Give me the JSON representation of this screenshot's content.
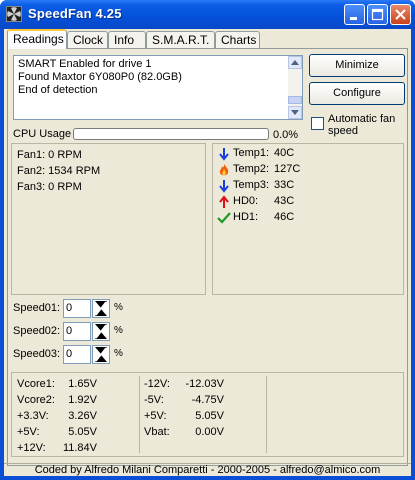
{
  "window": {
    "title": "SpeedFan 4.25",
    "icons": {
      "app": "speedfan-app-icon",
      "minimize": "minimize-icon",
      "maximize": "maximize-icon",
      "close": "close-icon"
    }
  },
  "tabs": [
    {
      "label": "Readings",
      "active": true
    },
    {
      "label": "Clock",
      "active": false
    },
    {
      "label": "Info",
      "active": false
    },
    {
      "label": "S.M.A.R.T.",
      "active": false
    },
    {
      "label": "Charts",
      "active": false
    }
  ],
  "log": {
    "lines": [
      "SMART Enabled for drive 1",
      "Found Maxtor 6Y080P0 (82.0GB)",
      "End of detection"
    ]
  },
  "buttons": {
    "minimize": "Minimize",
    "configure": "Configure"
  },
  "auto_fan": {
    "label": "Automatic fan speed",
    "checked": false
  },
  "cpu": {
    "label": "CPU Usage",
    "value": "0.0%",
    "fraction": 0.0
  },
  "fans": [
    "Fan1: 0 RPM",
    "Fan2: 1534 RPM",
    "Fan3: 0 RPM"
  ],
  "temps": [
    {
      "label": "Temp1:",
      "value": "40C",
      "icon": "arrow-down-icon",
      "color": "#1a3fe0"
    },
    {
      "label": "Temp2:",
      "value": "127C",
      "icon": "flame-icon",
      "color": "#e03010"
    },
    {
      "label": "Temp3:",
      "value": "33C",
      "icon": "arrow-down-icon",
      "color": "#1a3fe0"
    },
    {
      "label": "HD0:",
      "value": "43C",
      "icon": "arrow-up-icon",
      "color": "#e01010"
    },
    {
      "label": "HD1:",
      "value": "46C",
      "icon": "check-icon",
      "color": "#1f9a22"
    }
  ],
  "speeds": [
    {
      "label": "Speed01:",
      "value": "0",
      "unit": "%"
    },
    {
      "label": "Speed02:",
      "value": "0",
      "unit": "%"
    },
    {
      "label": "Speed03:",
      "value": "0",
      "unit": "%"
    }
  ],
  "voltages_left": [
    {
      "label": "Vcore1:",
      "value": "1.65V"
    },
    {
      "label": "Vcore2:",
      "value": "1.92V"
    },
    {
      "label": "+3.3V:",
      "value": "3.26V"
    },
    {
      "label": "+5V:",
      "value": "5.05V"
    },
    {
      "label": "+12V:",
      "value": "11.84V"
    }
  ],
  "voltages_right": [
    {
      "label": "-12V:",
      "value": "-12.03V"
    },
    {
      "label": "-5V:",
      "value": "-4.75V"
    },
    {
      "label": "+5V:",
      "value": "5.05V"
    },
    {
      "label": "Vbat:",
      "value": "0.00V"
    }
  ],
  "status": "Coded by Alfredo Milani Comparetti - 2000-2005 - alfredo@almico.com"
}
